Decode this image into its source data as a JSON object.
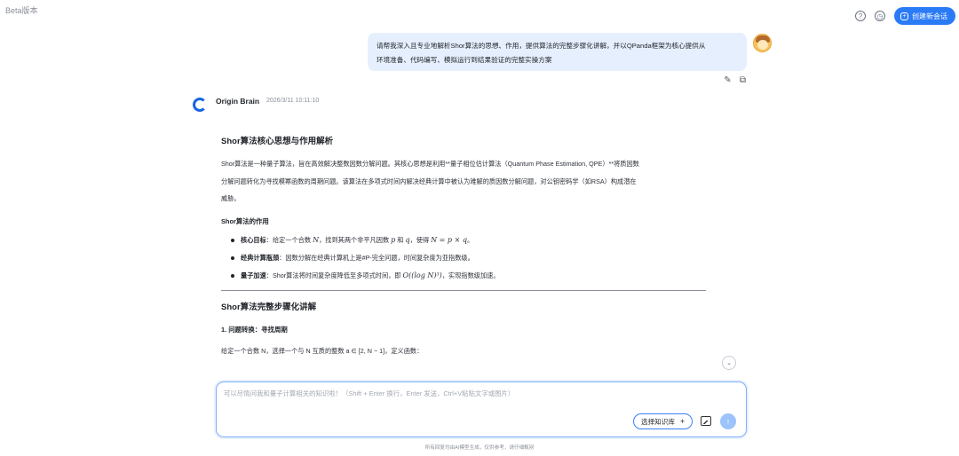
{
  "app": {
    "beta_label": "Beta版本"
  },
  "header": {
    "help_icon": "question-circle-icon",
    "history_icon": "clock-icon",
    "new_chat_label": "创建新会话"
  },
  "user_message": {
    "line1": "请帮我深入且专业地解析Shor算法的思想、作用，提供算法的完整步骤化讲解，并以QPanda框架为核心提供从",
    "line2": "环境准备、代码编写、模拟运行到结果验证的完整实操方案"
  },
  "assistant": {
    "name": "Origin Brain",
    "timestamp": "2026/3/11 10:11:10",
    "section1_title": "Shor算法核心思想与作用解析",
    "intro_line1": "Shor算法是一种量子算法，旨在高效解决整数因数分解问题。其核心思想是利用**量子相位估计算法（Quantum Phase Estimation, QPE）**将质因数",
    "intro_line2": "分解问题转化为寻找模幂函数的周期问题。该算法在多项式时间内解决经典计算中被认为难解的质因数分解问题，对公钥密码学（如RSA）构成潜在",
    "intro_line3": "威胁。",
    "section1_sub": "Shor算法的作用",
    "bullets": [
      {
        "label": "核心目标",
        "pre": "：给定一个合数 ",
        "math1": "N",
        "mid": "，找到其两个非平凡因数 ",
        "math2": "p",
        "and": " 和 ",
        "math3": "q",
        "mid2": "，使得 ",
        "math4": "N = p × q",
        "end": "。"
      },
      {
        "label": "经典计算瓶颈",
        "text": "：因数分解在经典计算机上是#P-完全问题，时间复杂度为亚指数级。"
      },
      {
        "label": "量子加速",
        "pre": "：Shor算法将时间复杂度降低至多项式时间，即 ",
        "math": "O((log N)³)",
        "end": "，实现指数级加速。"
      }
    ],
    "section2_title": "Shor算法完整步骤化讲解",
    "step1_title": "1. 问题转换：寻找周期",
    "step1_partial": "给定一个合数 N，选择一个与 N 互质的整数 a ∈ [2, N − 1]，定义函数："
  },
  "composer": {
    "placeholder": "可以尽情问我和量子计算相关的知识啦！（Shift + Enter 换行，Enter 发送，Ctrl+V粘贴文字或图片）",
    "knowledge_button": "选择知识库",
    "knowledge_plus": "+",
    "image_icon": "image-icon",
    "send_icon": "arrow-up-icon"
  },
  "footer": {
    "disclaimer": "所有回复均由AI模型生成，仅供参考，请仔细甄别"
  }
}
